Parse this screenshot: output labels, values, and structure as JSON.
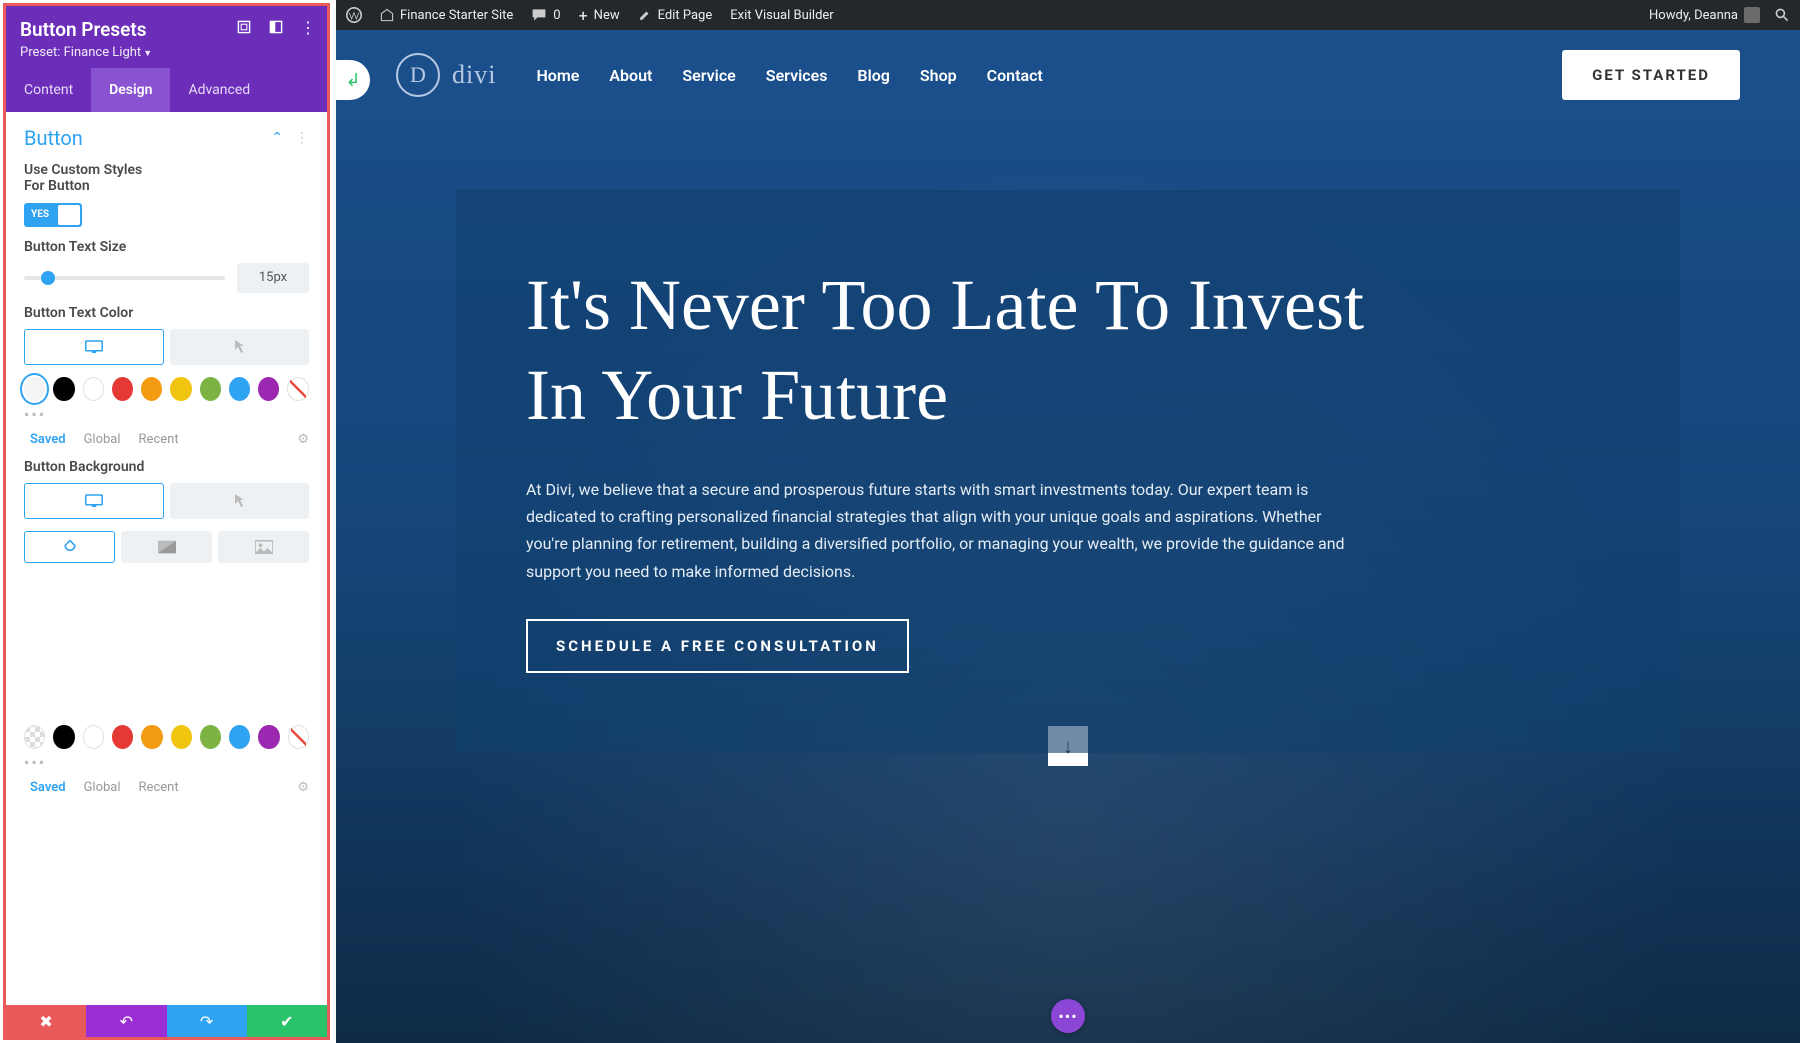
{
  "admin_bar": {
    "site_name": "Finance Starter Site",
    "comment_count": "0",
    "new_label": "New",
    "edit_page": "Edit Page",
    "exit_vb": "Exit Visual Builder",
    "greeting": "Howdy, Deanna"
  },
  "panel": {
    "title": "Button Presets",
    "preset_prefix": "Preset: ",
    "preset_name": "Finance Light",
    "tabs": [
      "Content",
      "Design",
      "Advanced"
    ],
    "active_tab": 1,
    "section_title": "Button",
    "labels": {
      "custom_styles": "Use Custom Styles For Button",
      "text_size": "Button Text Size",
      "text_color": "Button Text Color",
      "background": "Button Background"
    },
    "toggle_yes": "YES",
    "text_size_value": "15px",
    "palette_tabs": {
      "saved": "Saved",
      "global": "Global",
      "recent": "Recent"
    },
    "swatch_colors": [
      "#000000",
      "#ffffff",
      "#e53935",
      "#f39c12",
      "#f1c40f",
      "#7cb342",
      "#2ea3f2",
      "#9c27b0"
    ]
  },
  "site": {
    "logo_letter": "D",
    "logo_text": "divi",
    "nav": [
      "Home",
      "About",
      "Service",
      "Services",
      "Blog",
      "Shop",
      "Contact"
    ],
    "cta": "GET STARTED",
    "hero_title": "It's Never Too Late To Invest In Your Future",
    "hero_body": "At Divi, we believe that a secure and prosperous future starts with smart investments today. Our expert team is dedicated to crafting personalized financial strategies that align with your unique goals and aspirations. Whether you're planning for retirement, building a diversified portfolio, or managing your wealth, we provide the guidance and support you need to make informed decisions.",
    "schedule_btn": "SCHEDULE A FREE CONSULTATION"
  }
}
